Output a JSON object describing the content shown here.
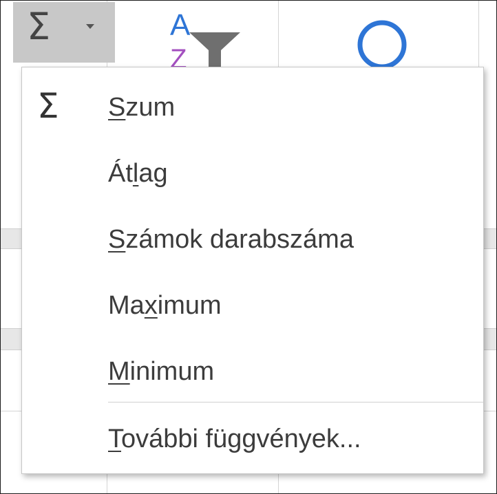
{
  "ribbon": {
    "autosum_symbol": "Σ",
    "sort_icon_letter_top": "A",
    "sort_icon_letter_bottom": "Z"
  },
  "menu": {
    "items": [
      {
        "icon": "Σ",
        "pre": "",
        "accel": "S",
        "post": "zum"
      },
      {
        "icon": "",
        "pre": "Át",
        "accel": "l",
        "post": "ag"
      },
      {
        "icon": "",
        "pre": "",
        "accel": "S",
        "post": "zámok darabszáma"
      },
      {
        "icon": "",
        "pre": "Ma",
        "accel": "x",
        "post": "imum"
      },
      {
        "icon": "",
        "pre": "",
        "accel": "M",
        "post": "inimum"
      },
      {
        "icon": "",
        "pre": "",
        "accel": "T",
        "post": "ovábbi függvények..."
      }
    ]
  },
  "colors": {
    "button_hover": "#c8c8c8",
    "text": "#3c3c3c",
    "sort_blue": "#2e75d6",
    "sort_purple": "#a34fbf",
    "filter_gray": "#6f6f6f",
    "find_blue": "#2e75d6"
  }
}
